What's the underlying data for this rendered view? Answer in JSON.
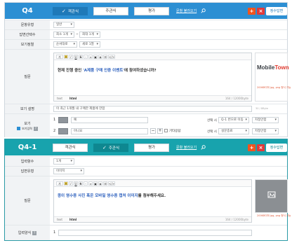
{
  "q4": {
    "title": "Q4",
    "tabs": [
      {
        "label": "객관식",
        "active": true
      },
      {
        "label": "주관식",
        "active": false
      },
      {
        "label": "평가",
        "active": false
      }
    ],
    "link_label": "문항 불러오기",
    "plus_label": "+",
    "close_label": "×",
    "answer_label": "정수답변",
    "rows": {
      "type": {
        "label": "문항유형",
        "value": "일반"
      },
      "count": {
        "label": "답변선택수",
        "min": "최소 1개",
        "max": "최대 1개"
      },
      "order": {
        "label": "보기정렬",
        "sort": "순서대로",
        "cols": "세로 1열"
      },
      "question": {
        "label": "질문",
        "text_plain1": "현재 진행 중인 ",
        "text_highlight": "'A제품 구매 인증 이벤트'",
        "text_plain2": "에 참여하셨습니까?",
        "tab_text": "text",
        "tab_html": "html",
        "count": "164 / 12000byte",
        "brand_a": "Mobile",
        "brand_b": "Town",
        "img_caption": "200KB이하 jpg, png 형식 가능"
      },
      "desc": {
        "label": "보기 설명",
        "value": "이 최근 1개월 내 구매한 제품에 한함",
        "count": "30 / 8Byte"
      },
      "options": {
        "label": "보기",
        "checkbox_label": "보기입력",
        "items": [
          {
            "num": "1",
            "text": "예",
            "select_label": "선택 시",
            "goto": "Q-1 번으로 이동",
            "action": "지정안함"
          },
          {
            "num": "2",
            "text": "아니요",
            "select_label": "선택 시",
            "goto": "설문종료",
            "action": "지정안함",
            "other": "기타응답"
          }
        ]
      }
    }
  },
  "q41": {
    "title": "Q4-1",
    "tabs": [
      {
        "label": "객관식",
        "active": false
      },
      {
        "label": "주관식",
        "active": true
      },
      {
        "label": "평가",
        "active": false
      }
    ],
    "link_label": "문항 불러오기",
    "plus_label": "+",
    "close_label": "×",
    "answer_label": "정수답변",
    "rows": {
      "count": {
        "label": "입력항수",
        "value": "1개"
      },
      "type": {
        "label": "답변유형",
        "value": "이미지"
      },
      "question": {
        "label": "질문",
        "text_highlight": "종이 영수증 사진 혹은 모바일 영수증 캡처 이미지",
        "text_plain": "를 첨부해주세요.",
        "tab_text": "text",
        "tab_html": "html",
        "count": "164 / 12000byte",
        "img_caption": "200KB이하 jpg, png 형식 가능"
      },
      "input": {
        "label": "입력양식",
        "num": "1"
      }
    }
  },
  "toolbar_items": [
    "가",
    "A",
    "I",
    "U",
    "S",
    "-",
    "∞",
    "▣",
    "◈",
    "☰",
    "</>"
  ],
  "colors": {
    "q4_header": "#2c8fd3",
    "q41_header": "#18a3ad",
    "plus": "#f0541e",
    "close": "#e23a3a"
  }
}
